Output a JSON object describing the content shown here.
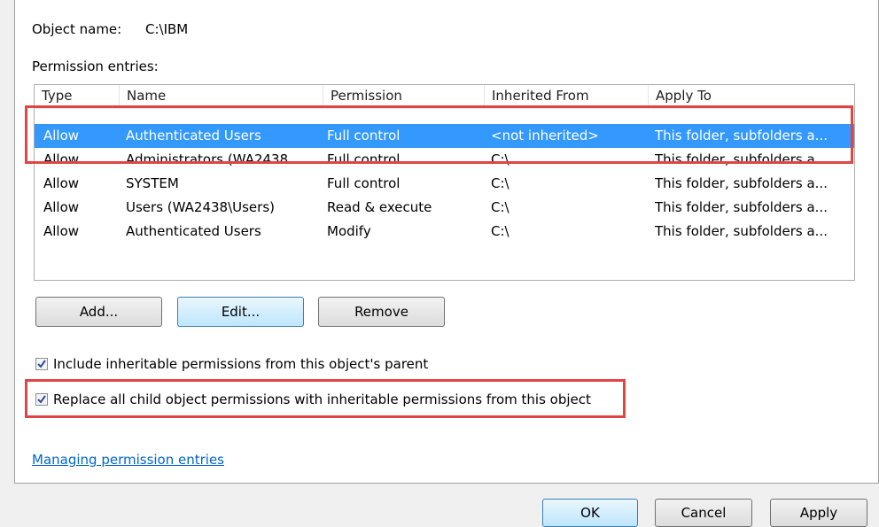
{
  "object": {
    "name_label": "Object name:",
    "name_value": "C:\\IBM"
  },
  "permissions": {
    "label": "Permission entries:",
    "columns": [
      "Type",
      "Name",
      "Permission",
      "Inherited From",
      "Apply To"
    ],
    "rows": [
      {
        "type": "Allow",
        "name": "Authenticated Users",
        "permission": "Full control",
        "inherited_from": "<not inherited>",
        "apply_to": "This folder, subfolders a..."
      },
      {
        "type": "Allow",
        "name": "Administrators (WA2438...",
        "permission": "Full control",
        "inherited_from": "C:\\",
        "apply_to": "This folder, subfolders a..."
      },
      {
        "type": "Allow",
        "name": "SYSTEM",
        "permission": "Full control",
        "inherited_from": "C:\\",
        "apply_to": "This folder, subfolders a..."
      },
      {
        "type": "Allow",
        "name": "Users (WA2438\\Users)",
        "permission": "Read & execute",
        "inherited_from": "C:\\",
        "apply_to": "This folder, subfolders a..."
      },
      {
        "type": "Allow",
        "name": "Authenticated Users",
        "permission": "Modify",
        "inherited_from": "C:\\",
        "apply_to": "This folder, subfolders a..."
      }
    ]
  },
  "buttons": {
    "add": "Add...",
    "edit": "Edit...",
    "remove": "Remove"
  },
  "options": {
    "include_inheritable": {
      "label": "Include inheritable permissions from this object's parent",
      "checked": true
    },
    "replace_child": {
      "label": "Replace all child object permissions with inheritable permissions from this object",
      "checked": true
    }
  },
  "link": {
    "managing": "Managing permission entries"
  },
  "footer": {
    "ok": "OK",
    "cancel": "Cancel",
    "apply": "Apply"
  },
  "colors": {
    "selection": "#3399ff",
    "highlight_box": "#e04545",
    "link": "#0066cc"
  }
}
